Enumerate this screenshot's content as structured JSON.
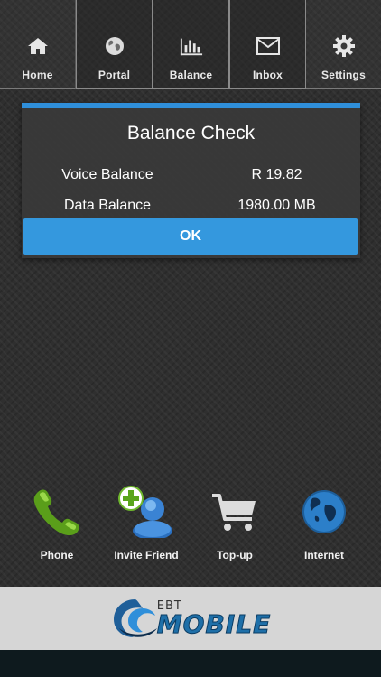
{
  "tabs": [
    {
      "label": "Home",
      "icon": "home-icon"
    },
    {
      "label": "Portal",
      "icon": "globe-icon"
    },
    {
      "label": "Balance",
      "icon": "bar-chart-icon"
    },
    {
      "label": "Inbox",
      "icon": "envelope-icon"
    },
    {
      "label": "Settings",
      "icon": "gear-icon"
    }
  ],
  "dialog": {
    "title": "Balance Check",
    "rows": [
      {
        "label": "Voice Balance",
        "value": "R 19.82"
      },
      {
        "label": "Data Balance",
        "value": "1980.00 MB"
      }
    ],
    "ok_label": "OK"
  },
  "actions": [
    {
      "label": "Phone",
      "icon": "phone-icon"
    },
    {
      "label": "Invite Friend",
      "icon": "invite-friend-icon"
    },
    {
      "label": "Top-up",
      "icon": "cart-icon"
    },
    {
      "label": "Internet",
      "icon": "globe-icon"
    }
  ],
  "footer": {
    "logo_small": "EBT",
    "logo_big": "MOBILE"
  },
  "colors": {
    "accent": "#3498de",
    "background": "#2f2f2f",
    "footer": "#d6d6d6"
  }
}
